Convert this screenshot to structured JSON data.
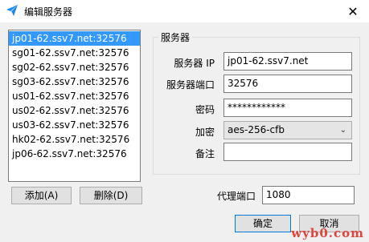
{
  "window": {
    "title": "编辑服务器",
    "close_glyph": "✕",
    "icon": "paper-plane-icon"
  },
  "server_list": {
    "items": [
      "jp01-62.ssv7.net:32576",
      "sg01-62.ssv7.net:32576",
      "sg02-62.ssv7.net:32576",
      "sg03-62.ssv7.net:32576",
      "us01-62.ssv7.net:32576",
      "us02-62.ssv7.net:32576",
      "us03-62.ssv7.net:32576",
      "hk02-62.ssv7.net:32576",
      "jp06-62.ssv7.net:32576"
    ],
    "selected_index": 0
  },
  "buttons": {
    "add": "添加(A)",
    "delete": "删除(D)",
    "ok": "确定",
    "cancel": "取消"
  },
  "server_group": {
    "title": "服务器",
    "server_ip_label": "服务器 IP",
    "server_ip_value": "jp01-62.ssv7.net",
    "port_label": "服务器端口",
    "port_value": "32576",
    "password_label": "密码",
    "password_value": "************",
    "encryption_label": "加密",
    "encryption_value": "aes-256-cfb",
    "remark_label": "备注",
    "remark_value": ""
  },
  "proxy_port": {
    "label": "代理端口",
    "value": "1080"
  },
  "watermark": "wyb0.com",
  "colors": {
    "selection": "#3399ff",
    "icon_blue": "#1e88e5",
    "watermark": "#e0443c"
  }
}
